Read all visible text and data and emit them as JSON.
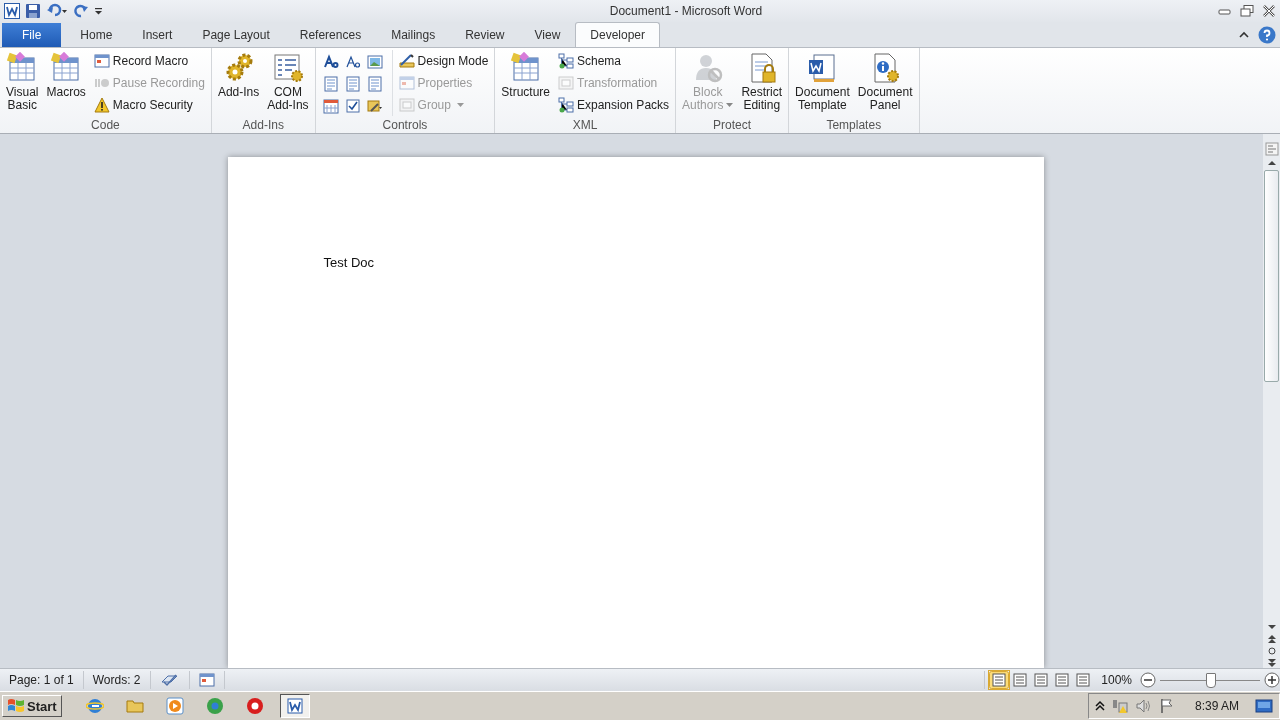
{
  "window": {
    "title": "Document1 -  Microsoft Word"
  },
  "tabs": [
    {
      "label": "File",
      "kind": "file",
      "selected": false
    },
    {
      "label": "Home",
      "kind": "tab",
      "selected": false
    },
    {
      "label": "Insert",
      "kind": "tab",
      "selected": false
    },
    {
      "label": "Page Layout",
      "kind": "tab",
      "selected": false
    },
    {
      "label": "References",
      "kind": "tab",
      "selected": false
    },
    {
      "label": "Mailings",
      "kind": "tab",
      "selected": false
    },
    {
      "label": "Review",
      "kind": "tab",
      "selected": false
    },
    {
      "label": "View",
      "kind": "tab",
      "selected": false
    },
    {
      "label": "Developer",
      "kind": "tab",
      "selected": true
    }
  ],
  "ribbon_groups": [
    {
      "label": "Code",
      "items": [
        {
          "kind": "large",
          "label": "Visual\nBasic",
          "disabled": false,
          "dropdown": false
        },
        {
          "kind": "large",
          "label": "Macros",
          "disabled": false,
          "dropdown": false
        },
        {
          "kind": "small",
          "label": "Record Macro",
          "disabled": false,
          "dropdown": false
        },
        {
          "kind": "small",
          "label": "Pause Recording",
          "disabled": true,
          "dropdown": false
        },
        {
          "kind": "small",
          "label": "Macro Security",
          "disabled": false,
          "dropdown": false
        }
      ]
    },
    {
      "label": "Add-Ins",
      "items": [
        {
          "kind": "large",
          "label": "Add-Ins",
          "disabled": false,
          "dropdown": false
        },
        {
          "kind": "large",
          "label": "COM\nAdd-Ins",
          "disabled": false,
          "dropdown": false
        }
      ]
    },
    {
      "label": "Controls",
      "items": [
        {
          "kind": "grid",
          "disabled": false,
          "dropdown": false
        },
        {
          "kind": "small",
          "label": "Design Mode",
          "disabled": false,
          "dropdown": false
        },
        {
          "kind": "small",
          "label": "Properties",
          "disabled": true,
          "dropdown": false
        },
        {
          "kind": "small",
          "label": "Group",
          "disabled": true,
          "dropdown": true
        }
      ]
    },
    {
      "label": "XML",
      "items": [
        {
          "kind": "large",
          "label": "Structure",
          "disabled": false,
          "dropdown": false
        },
        {
          "kind": "small",
          "label": "Schema",
          "disabled": false,
          "dropdown": false
        },
        {
          "kind": "small",
          "label": "Transformation",
          "disabled": true,
          "dropdown": false
        },
        {
          "kind": "small",
          "label": "Expansion Packs",
          "disabled": false,
          "dropdown": false
        }
      ]
    },
    {
      "label": "Protect",
      "items": [
        {
          "kind": "large",
          "label": "Block\nAuthors",
          "disabled": true,
          "dropdown": true
        },
        {
          "kind": "large",
          "label": "Restrict\nEditing",
          "disabled": false,
          "dropdown": false
        }
      ]
    },
    {
      "label": "Templates",
      "items": [
        {
          "kind": "large",
          "label": "Document\nTemplate",
          "disabled": false,
          "dropdown": false
        },
        {
          "kind": "large",
          "label": "Document\nPanel",
          "disabled": false,
          "dropdown": false
        }
      ]
    }
  ],
  "document": {
    "text": "Test Doc"
  },
  "status_bar": {
    "page": "Page: 1 of 1",
    "words": "Words: 2",
    "view_buttons": [
      {
        "selected": true
      },
      {
        "selected": false
      },
      {
        "selected": false
      },
      {
        "selected": false
      },
      {
        "selected": false
      }
    ],
    "zoom": "100%",
    "zoom_slider": {
      "level": 0.5
    }
  },
  "taskbar": {
    "start": "Start",
    "apps": [
      {
        "selected": false
      },
      {
        "selected": false
      },
      {
        "selected": false
      },
      {
        "selected": false
      },
      {
        "selected": false
      },
      {
        "selected": true
      }
    ],
    "clock": "8:39 AM"
  }
}
